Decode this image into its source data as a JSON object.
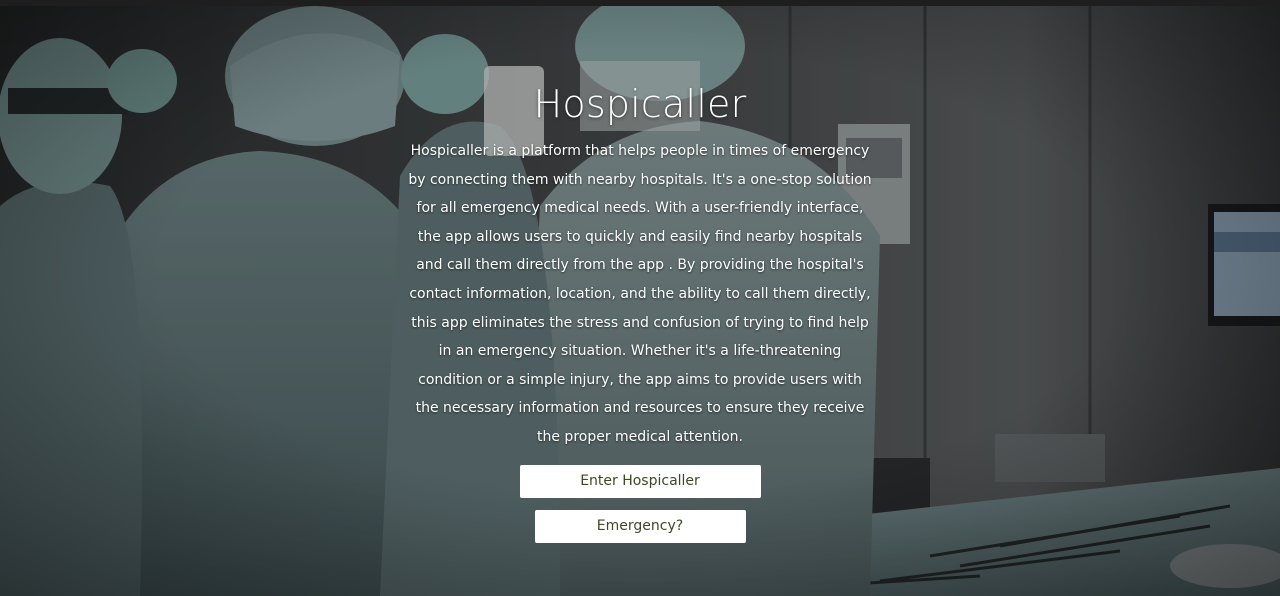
{
  "hero": {
    "title": "Hospicaller",
    "description": "Hospicaller is a platform that helps people in times of emergency by connecting them with nearby hospitals. It's a one-stop solution for all emergency medical needs. With a user-friendly interface, the app allows users to quickly and easily find nearby hospitals and call them directly from the app . By providing the hospital's contact information, location, and the ability to call them directly, this app eliminates the stress and confusion of trying to find help in an emergency situation. Whether it's a life-threatening condition or a simple injury, the app aims to provide users with the necessary information and resources to ensure they receive the proper medical attention.",
    "background_image": "surgeons-in-operating-room-photo"
  },
  "buttons": {
    "enter_label": "Enter Hospicaller",
    "emergency_label": "Emergency?"
  },
  "colors": {
    "button_bg": "#ffffff",
    "button_text": "#3b4a22",
    "hero_text": "#ffffff"
  }
}
